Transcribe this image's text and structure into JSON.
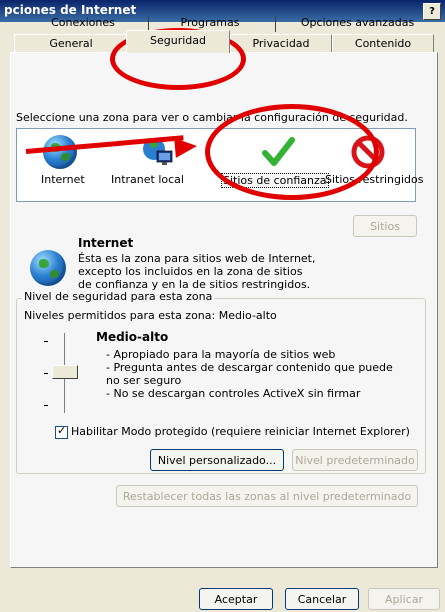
{
  "window": {
    "title": "pciones de Internet",
    "help_label": "?"
  },
  "tabs": {
    "row1": [
      {
        "label": "Conexiones"
      },
      {
        "label": "Programas"
      },
      {
        "label": "Opciones avanzadas"
      }
    ],
    "row2": [
      {
        "label": "General"
      },
      {
        "label": "Seguridad"
      },
      {
        "label": "Privacidad"
      },
      {
        "label": "Contenido"
      }
    ],
    "active": "Seguridad"
  },
  "zones": {
    "instruction": "Seleccione una zona para ver o cambiar la configuración de seguridad.",
    "items": [
      {
        "label": "Internet",
        "icon": "globe-icon"
      },
      {
        "label": "Intranet local",
        "icon": "intranet-icon"
      },
      {
        "label": "Sitios de confianza",
        "icon": "checkmark-icon"
      },
      {
        "label": "Sitios restringidos",
        "icon": "no-entry-icon"
      }
    ],
    "selected": "Sitios de confianza"
  },
  "zone_info": {
    "title": "Internet",
    "description": "Ésta es la zona para sitios web de Internet, excepto los incluidos en la zona de sitios de confianza y en la de sitios restringidos.",
    "sites_button": "Sitios"
  },
  "security_level": {
    "group_label": "Nivel de seguridad para esta zona",
    "allowed_levels": "Niveles permitidos para esta zona: Medio-alto",
    "level_name": "Medio-alto",
    "bullets": [
      "- Apropiado para la mayoría de sitios web",
      "- Pregunta antes de descargar contenido que puede no ser seguro",
      "- No se descargan controles ActiveX sin firmar"
    ],
    "protected_mode_label": "Habilitar Modo protegido (requiere reiniciar Internet Explorer)",
    "protected_mode_checked": true,
    "custom_button": "Nivel personalizado...",
    "default_button": "Nivel predeterminado",
    "reset_button": "Restablecer todas las zonas al nivel predeterminado"
  },
  "footer": {
    "ok": "Aceptar",
    "cancel": "Cancelar",
    "apply": "Aplicar"
  },
  "colors": {
    "annotation": "#e00000",
    "window_bg": "#ece9d8",
    "panel_bg": "#f6f6f6"
  }
}
